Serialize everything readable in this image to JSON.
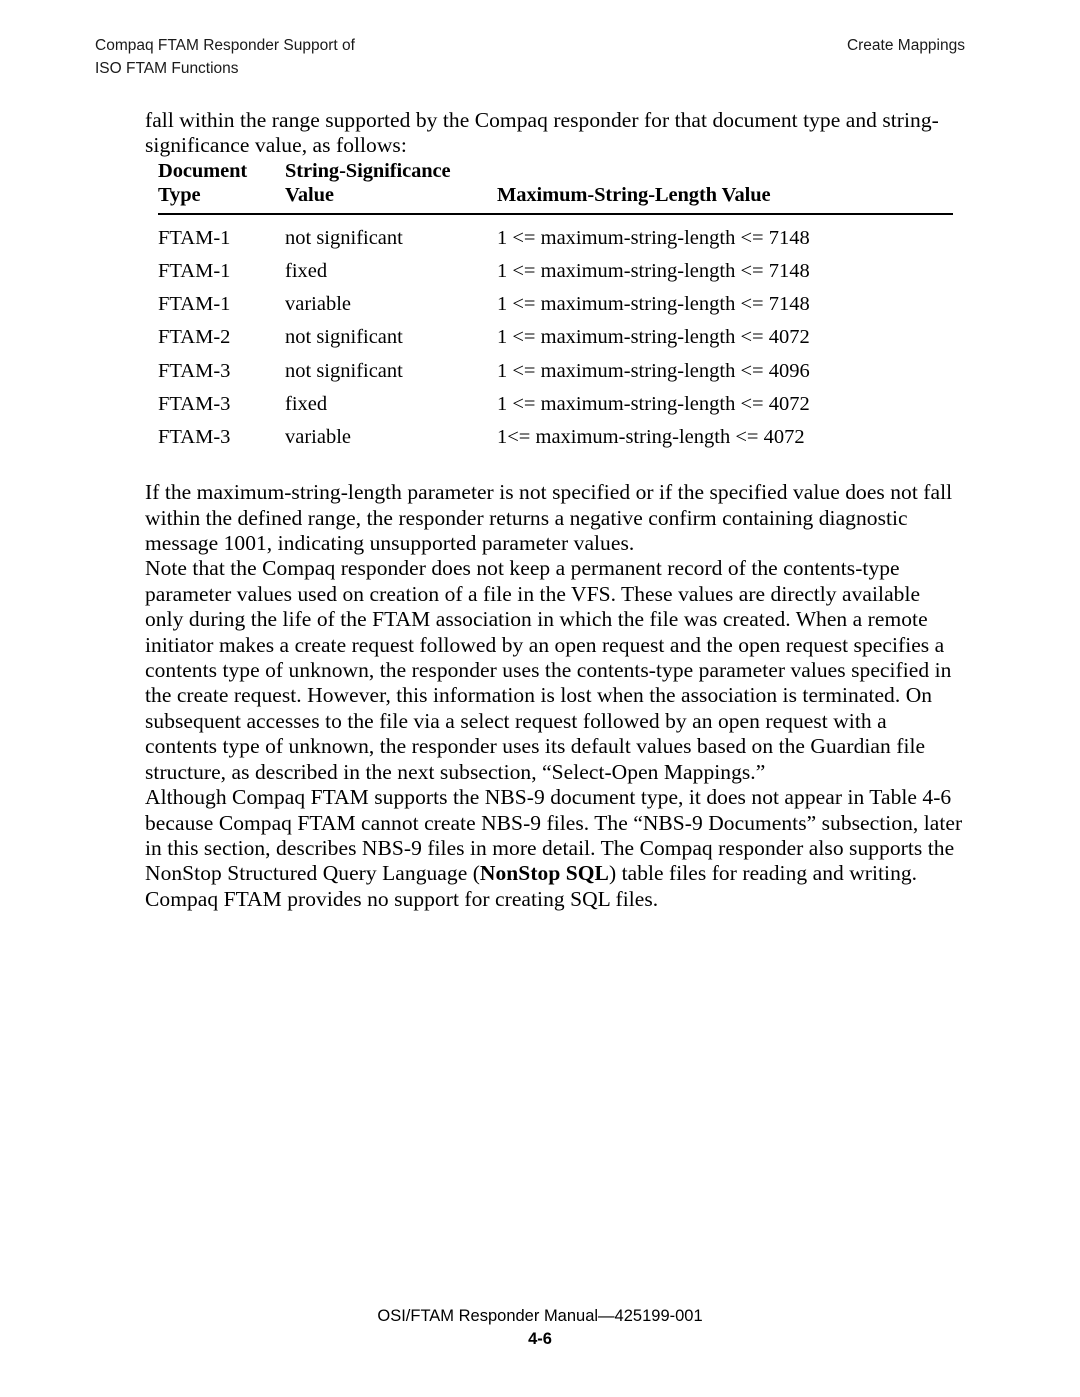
{
  "header": {
    "left_line1": "Compaq FTAM Responder Support of",
    "left_line2": "ISO FTAM Functions",
    "right": "Create Mappings"
  },
  "intro_paragraph": "fall within the range supported by the Compaq responder for that document type and string-significance value, as follows:",
  "table": {
    "columns": [
      {
        "line1": "Document",
        "line2": "Type"
      },
      {
        "line1": "String-Significance",
        "line2": "Value"
      },
      {
        "line1": "",
        "line2": "Maximum-String-Length Value"
      }
    ],
    "rows": [
      {
        "document_type": "FTAM-1",
        "string_significance": "not significant",
        "maximum_string_length": "1 <= maximum-string-length <= 7148"
      },
      {
        "document_type": "FTAM-1",
        "string_significance": "fixed",
        "maximum_string_length": "1 <= maximum-string-length <= 7148"
      },
      {
        "document_type": "FTAM-1",
        "string_significance": "variable",
        "maximum_string_length": "1 <= maximum-string-length <= 7148"
      },
      {
        "document_type": "FTAM-2",
        "string_significance": "not significant",
        "maximum_string_length": "1 <= maximum-string-length <= 4072"
      },
      {
        "document_type": "FTAM-3",
        "string_significance": "not significant",
        "maximum_string_length": "1 <= maximum-string-length <= 4096"
      },
      {
        "document_type": "FTAM-3",
        "string_significance": "fixed",
        "maximum_string_length": "1 <= maximum-string-length <= 4072"
      },
      {
        "document_type": "FTAM-3",
        "string_significance": "variable",
        "maximum_string_length": "1<= maximum-string-length <= 4072"
      }
    ]
  },
  "paragraphs": {
    "range_error": "If the maximum-string-length parameter is not specified or if the specified value does not fall within the defined range, the responder returns a negative confirm containing diagnostic message 1001, indicating unsupported parameter values.",
    "contents_type_note": "Note that the Compaq responder does not keep a permanent record of the contents-type parameter values used on creation of a file in the VFS.  These values are directly available only during the life of the FTAM association in which the file was created.  When a remote initiator makes a create request followed by an open request and the open request specifies a contents type of unknown, the responder uses the contents-type parameter values specified in the create request.  However, this information is lost when the association is terminated.  On subsequent accesses to the file via a select request followed by an open request with a contents type of unknown, the responder uses its default values based on the Guardian file structure, as described in the next subsection, “Select-Open Mappings.”",
    "nbs9_part1": "Although Compaq FTAM supports the NBS-9 document type, it does not appear in Table 4-6 because Compaq FTAM cannot create NBS-9 files.  The “NBS-9 Documents” subsection, later in this section, describes NBS-9 files in more detail.  The Compaq responder also supports the NonStop Structured Query Language (",
    "nbs9_bold": "NonStop SQL",
    "nbs9_part2": ") table files for reading and writing.  Compaq FTAM provides no support for creating SQL files."
  },
  "footer": {
    "manual": "OSI/FTAM Responder Manual—425199-001",
    "page_number": "4-6"
  }
}
